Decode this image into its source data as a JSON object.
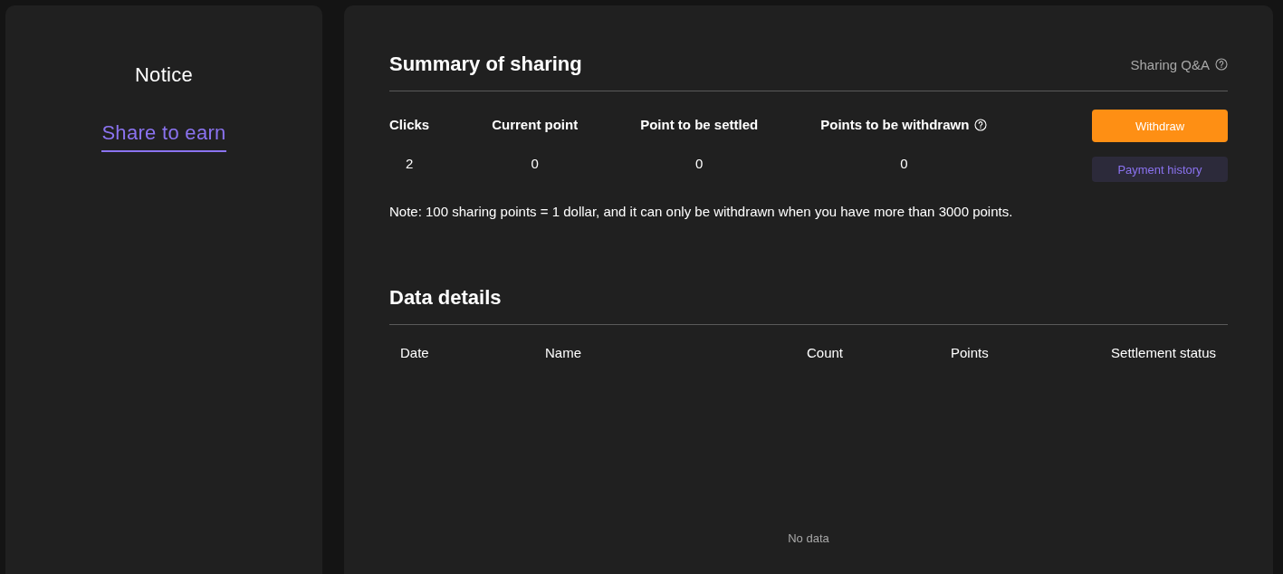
{
  "sidebar": {
    "items": [
      {
        "label": "Notice",
        "selected": false
      },
      {
        "label": "Share to earn",
        "selected": true
      }
    ]
  },
  "summary": {
    "title": "Summary of sharing",
    "help_link": "Sharing Q&A",
    "stats": [
      {
        "label": "Clicks",
        "value": "2",
        "has_help": false
      },
      {
        "label": "Current point",
        "value": "0",
        "has_help": false
      },
      {
        "label": "Point to be settled",
        "value": "0",
        "has_help": false
      },
      {
        "label": "Points to be withdrawn",
        "value": "0",
        "has_help": true
      }
    ],
    "buttons": [
      {
        "label": "Withdraw",
        "kind": "primary"
      },
      {
        "label": "Payment history",
        "kind": "secondary"
      }
    ],
    "note": "Note: 100 sharing points = 1 dollar, and it can only be withdrawn when you have more than 3000 points."
  },
  "details": {
    "title": "Data details",
    "table": {
      "columns": [
        "Date",
        "Name",
        "Count",
        "Points",
        "Settlement status"
      ],
      "empty_text": "No data"
    }
  }
}
